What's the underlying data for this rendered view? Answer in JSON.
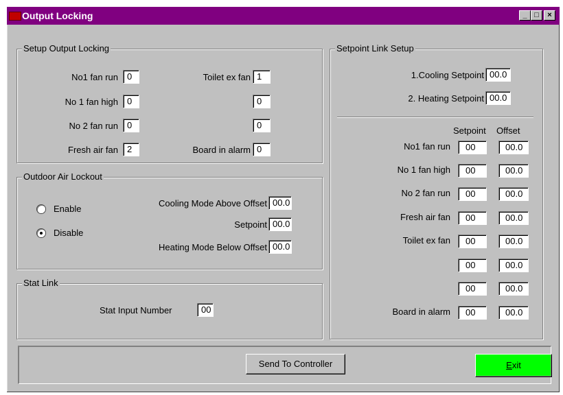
{
  "window": {
    "title": "Output Locking",
    "buttons": {
      "minimize": "_",
      "maximize": "□",
      "close": "×"
    }
  },
  "setup_output_locking": {
    "legend": "Setup Output Locking",
    "left": [
      {
        "label": "No1 fan run",
        "value": "0"
      },
      {
        "label": "No 1 fan high",
        "value": "0"
      },
      {
        "label": "No 2 fan run",
        "value": "0"
      },
      {
        "label": "Fresh air fan",
        "value": "2"
      }
    ],
    "right": [
      {
        "label": "Toilet ex fan",
        "value": "1"
      },
      {
        "label": "",
        "value": "0"
      },
      {
        "label": "",
        "value": "0"
      },
      {
        "label": "Board in alarm",
        "value": "0"
      }
    ]
  },
  "outdoor_air_lockout": {
    "legend": "Outdoor Air Lockout",
    "enable_label": "Enable",
    "disable_label": "Disable",
    "selected": "Disable",
    "cooling_label": "Cooling Mode Above Offset",
    "cooling_value": "00.0",
    "setpoint_label": "Setpoint",
    "setpoint_value": "00.0",
    "heating_label": "Heating Mode Below Offset",
    "heating_value": "00.0"
  },
  "stat_link": {
    "legend": "Stat Link",
    "input_label": "Stat Input Number",
    "input_value": "00"
  },
  "setpoint_link_setup": {
    "legend": "Setpoint Link Setup",
    "cooling_label": "1.Cooling Setpoint",
    "cooling_value": "00.0",
    "heating_label": "2. Heating Setpoint",
    "heating_value": "00.0",
    "col_setpoint": "Setpoint",
    "col_offset": "Offset",
    "rows": [
      {
        "label": "No1 fan run",
        "setpoint": "00",
        "offset": "00.0"
      },
      {
        "label": "No 1 fan high",
        "setpoint": "00",
        "offset": "00.0"
      },
      {
        "label": "No 2 fan run",
        "setpoint": "00",
        "offset": "00.0"
      },
      {
        "label": "Fresh air fan",
        "setpoint": "00",
        "offset": "00.0"
      },
      {
        "label": "Toilet ex fan",
        "setpoint": "00",
        "offset": "00.0"
      },
      {
        "label": "",
        "setpoint": "00",
        "offset": "00.0"
      },
      {
        "label": "",
        "setpoint": "00",
        "offset": "00.0"
      },
      {
        "label": "Board in alarm",
        "setpoint": "00",
        "offset": "00.0"
      }
    ]
  },
  "footer": {
    "send_label": "Send To Controller",
    "exit_label_underlined": "E",
    "exit_label_rest": "xit"
  },
  "colors": {
    "titlebar": "#800080",
    "exit_button": "#00ff00",
    "face": "#c0c0c0"
  }
}
